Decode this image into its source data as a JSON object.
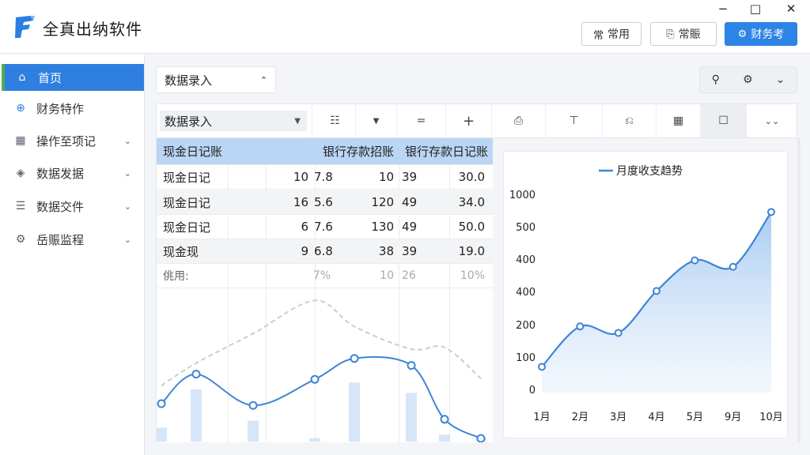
{
  "app": {
    "title": "全真出纳软件"
  },
  "window_controls": {
    "minimize": "−",
    "maximize": "□",
    "close": "✕"
  },
  "header_buttons": [
    {
      "icon": "常",
      "label": "常用"
    },
    {
      "icon": "⎘",
      "label": "常賑"
    },
    {
      "icon": "⚙",
      "label": "财务考"
    }
  ],
  "sidebar": {
    "items": [
      {
        "icon": "home-icon",
        "glyph": "⌂",
        "label": "首页",
        "active": true,
        "has_chevron": false
      },
      {
        "icon": "plus-circle-icon",
        "glyph": "⊕",
        "label": "财务特作",
        "active": false,
        "has_chevron": false
      },
      {
        "icon": "grid-icon",
        "glyph": "▦",
        "label": "操作至项记",
        "active": false,
        "has_chevron": true
      },
      {
        "icon": "shield-icon",
        "glyph": "◈",
        "label": "数据发据",
        "active": false,
        "has_chevron": true
      },
      {
        "icon": "database-icon",
        "glyph": "☰",
        "label": "数据交件",
        "active": false,
        "has_chevron": true
      },
      {
        "icon": "gear-icon",
        "glyph": "⚙",
        "label": "岳赈监程",
        "active": false,
        "has_chevron": true
      }
    ],
    "chevron": "⌄"
  },
  "toolbar_top": {
    "dropdown_label": "数据录入",
    "dropdown_chevron": "⌃",
    "right_icons": [
      "⚲",
      "⚙",
      "⌄"
    ]
  },
  "toolbar2": {
    "select_label": "数据录入",
    "select_arrow": "▼",
    "icons": [
      "☷",
      "▼",
      "=",
      "+",
      "⎙",
      "⊤",
      "⎌",
      "▦",
      "☐",
      "⌄⌄"
    ]
  },
  "table": {
    "headers": [
      "现金日记账",
      "银行存款招账",
      "银行存款日记账"
    ],
    "rows": [
      [
        "现金日记",
        "10",
        "7.8",
        "10",
        "39",
        "30.0"
      ],
      [
        "现金日记",
        "16",
        "5.6",
        "120",
        "49",
        "34.0"
      ],
      [
        "现金日记",
        "6",
        "7.6",
        "130",
        "49",
        "50.0"
      ],
      [
        "现金现",
        "9",
        "6.8",
        "38",
        "39",
        "19.0"
      ]
    ],
    "footer": [
      "佻用:",
      "7%",
      "10",
      "26",
      "10%"
    ]
  },
  "bg_chart": {
    "line_a": [
      20,
      37,
      19,
      34,
      46,
      42,
      11,
      0
    ],
    "line_b": [
      14,
      27,
      44,
      63,
      48,
      35,
      36,
      18
    ],
    "bars": [
      8,
      30,
      12,
      2,
      34,
      28,
      4,
      2
    ]
  },
  "chart_data": {
    "type": "area",
    "title": "月度收支趋势",
    "legend": "月度收支趋势",
    "categories": [
      "1月",
      "2月",
      "3月",
      "4月",
      "5月",
      "9月",
      "10月"
    ],
    "series": [
      {
        "name": "月度收支趋势",
        "values": [
          80,
          205,
          185,
          315,
          410,
          390,
          560
        ]
      }
    ],
    "y_ticks": [
      "1000",
      "500",
      "400",
      "400",
      "200",
      "100",
      "0"
    ],
    "color": "#3d85d6"
  }
}
